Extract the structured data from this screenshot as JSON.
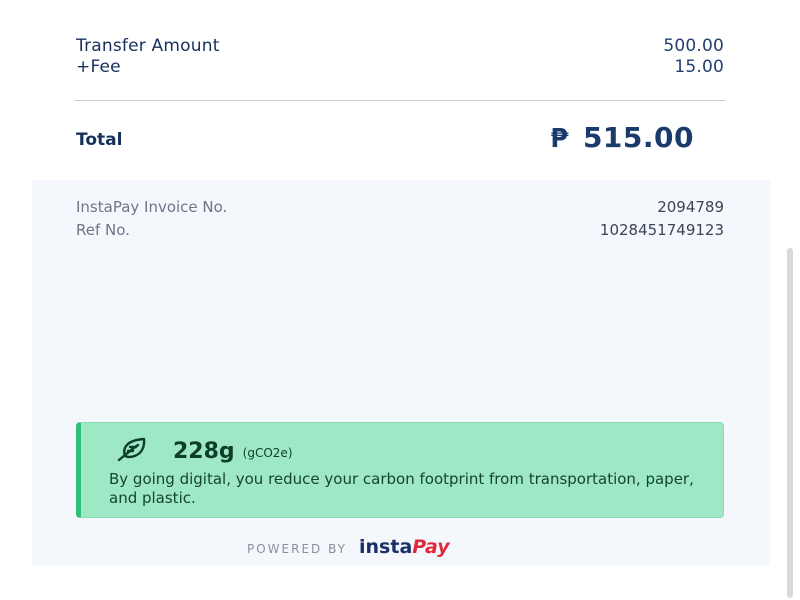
{
  "summary": {
    "transfer_amount_label": "Transfer Amount",
    "transfer_amount_value": "500.00",
    "fee_label": "+Fee",
    "fee_value": "15.00",
    "total_label": "Total",
    "currency_symbol": "₱",
    "total_value": "515.00"
  },
  "details": {
    "invoice_label": "InstaPay Invoice No.",
    "invoice_value": "2094789",
    "ref_label": "Ref No.",
    "ref_value": "1028451749123"
  },
  "eco": {
    "icon": "leaf-icon",
    "amount": "228g",
    "unit": "(gCO2e)",
    "message": "By going digital, you reduce your carbon footprint from transportation, paper, and plastic."
  },
  "footer": {
    "powered_by": "POWERED BY",
    "brand_insta": "insta",
    "brand_pay": "Pay"
  },
  "colors": {
    "primary_text": "#16305c",
    "banner_bg": "#9fe8c5",
    "banner_accent": "#2fbf78",
    "brand_red": "#e02a3a"
  }
}
